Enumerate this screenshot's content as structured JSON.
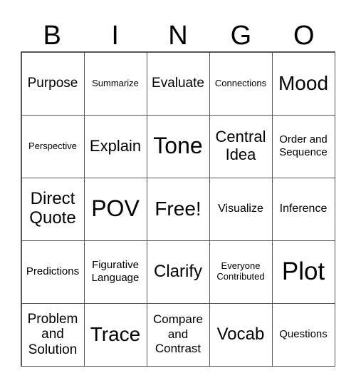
{
  "header": [
    "B",
    "I",
    "N",
    "G",
    "O"
  ],
  "cells": [
    [
      "Purpose",
      "Summarize",
      "Evaluate",
      "Connections",
      "Mood"
    ],
    [
      "Perspective",
      "Explain",
      "Tone",
      "Central Idea",
      "Order and Sequence"
    ],
    [
      "Direct Quote",
      "POV",
      "Free!",
      "Visualize",
      "Inference"
    ],
    [
      "Predictions",
      "Figurative Language",
      "Clarify",
      "Everyone Contributed",
      "Plot"
    ],
    [
      "Problem and Solution",
      "Trace",
      "Compare and Contrast",
      "Vocab",
      "Questions"
    ]
  ]
}
